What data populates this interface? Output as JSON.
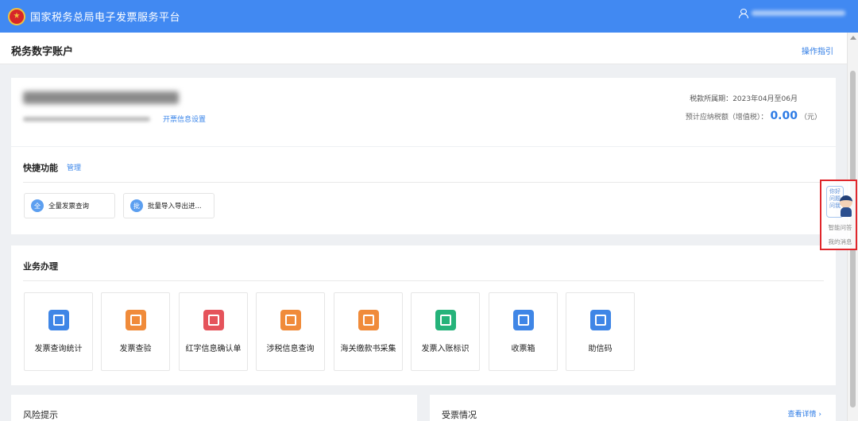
{
  "header": {
    "app_title": "国家税务总局电子发票服务平台",
    "emblem_icon": "national-emblem-icon",
    "user_icon": "user-icon"
  },
  "page": {
    "title": "税务数字账户",
    "guide_link": "操作指引"
  },
  "account": {
    "settings_link": "开票信息设置",
    "period_label": "税款所属期：",
    "period_value": "2023年04月至06月",
    "forecast_label": "预计应纳税额（增值税）：",
    "forecast_value": "0.00",
    "forecast_unit": "（元）"
  },
  "quick": {
    "title": "快捷功能",
    "manage": "管理",
    "items": [
      {
        "icon_text": "全",
        "label": "全量发票查询"
      },
      {
        "icon_text": "批",
        "label": "批量导入导出进..."
      }
    ]
  },
  "business": {
    "title": "业务办理",
    "items": [
      {
        "label": "发票查询统计",
        "icon": "invoice-search-icon",
        "color": "#3f86e6"
      },
      {
        "label": "发票查验",
        "icon": "invoice-verify-icon",
        "color": "#f08b3a"
      },
      {
        "label": "红字信息确认单",
        "icon": "red-letter-confirm-icon",
        "color": "#e5535b"
      },
      {
        "label": "涉税信息查询",
        "icon": "tax-info-search-icon",
        "color": "#f08b3a"
      },
      {
        "label": "海关缴款书采集",
        "icon": "customs-collect-icon",
        "color": "#f08b3a"
      },
      {
        "label": "发票入账标识",
        "icon": "invoice-booking-icon",
        "color": "#25b37a"
      },
      {
        "label": "收票箱",
        "icon": "mailbox-icon",
        "color": "#3f86e6"
      },
      {
        "label": "助信码",
        "icon": "qr-code-icon",
        "color": "#3f86e6"
      }
    ]
  },
  "risk": {
    "title": "风险提示"
  },
  "invoice": {
    "title": "受票情况",
    "view_detail": "查看详情 ›"
  },
  "assistant": {
    "bubble_text": "你好 问题 问我",
    "smart_qa": "智能问答",
    "my_messages": "我的消息"
  }
}
